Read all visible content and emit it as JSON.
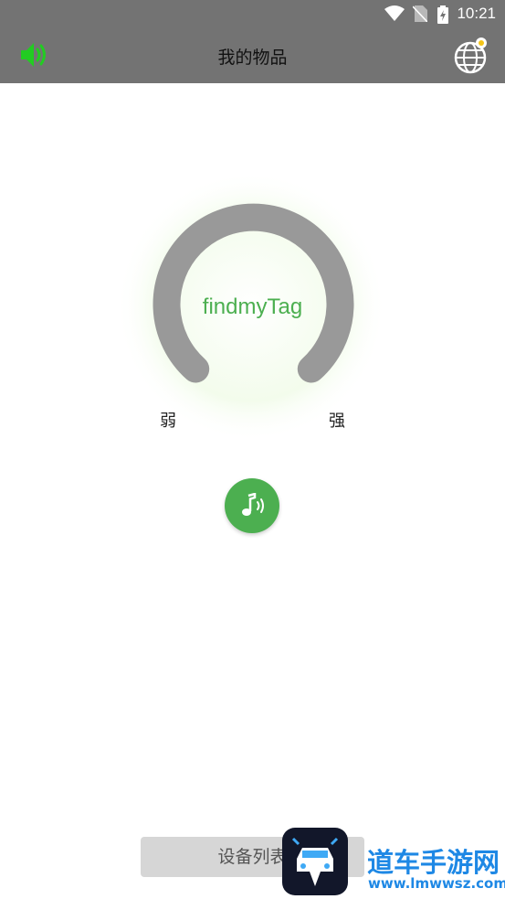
{
  "status_bar": {
    "time": "10:21",
    "icons": [
      "wifi-icon",
      "no-sim-icon",
      "battery-charging-icon"
    ]
  },
  "header": {
    "title": "我的物品",
    "left_icon": "speaker-icon",
    "right_icon": "globe-location-icon",
    "background": "#737373",
    "accent": "#22cc22"
  },
  "gauge": {
    "center_text": "findmyTag",
    "weak_label": "弱",
    "strong_label": "强",
    "arc_color": "#999999",
    "glow_color": "#f1fbe9",
    "text_color": "#4caf50"
  },
  "music_button": {
    "icon": "music-note-icon",
    "color": "#4caf50"
  },
  "bottom": {
    "device_list_label": "设备列表"
  },
  "watermark": {
    "title": "道车手游网",
    "url": "www.lmwwsz.com",
    "icon": "car-logo-icon"
  }
}
